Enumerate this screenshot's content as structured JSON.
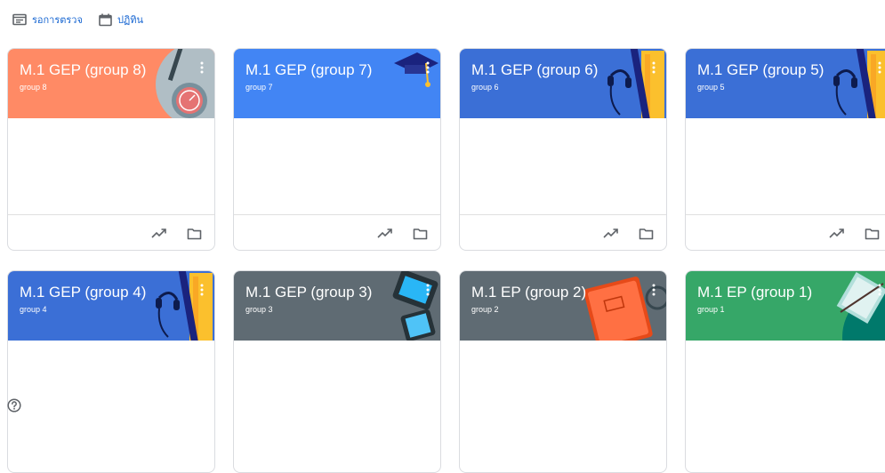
{
  "toolbar": {
    "to_review_label": "รอการตรวจ",
    "calendar_label": "ปฏิทิน"
  },
  "colors": {
    "orange": "#ff8a65",
    "blue": "#4285f4",
    "royal": "#3b6fd6",
    "slate": "#5f6b73",
    "green": "#36a768",
    "link": "#1967d2"
  },
  "classes": [
    {
      "title": "M.1 GEP (group 8)",
      "section": "group 8",
      "theme": "orange",
      "art": "compass-art"
    },
    {
      "title": "M.1 GEP (group 7)",
      "section": "group 7",
      "theme": "blue",
      "art": "graduation-cap-art"
    },
    {
      "title": "M.1 GEP (group 6)",
      "section": "group 6",
      "theme": "royal",
      "art": "books-headphones-art"
    },
    {
      "title": "M.1 GEP (group 5)",
      "section": "group 5",
      "theme": "royal",
      "art": "books-headphones-art"
    },
    {
      "title": "M.1 GEP (group 4)",
      "section": "group 4",
      "theme": "royal",
      "art": "books-headphones-art"
    },
    {
      "title": "M.1 GEP (group 3)",
      "section": "group 3",
      "theme": "slate",
      "art": "tablets-art"
    },
    {
      "title": "M.1 EP (group 2)",
      "section": "group 2",
      "theme": "slate",
      "art": "notebook-art"
    },
    {
      "title": "M.1 EP (group 1)",
      "section": "group 1",
      "theme": "green",
      "art": "book-leaf-art"
    }
  ],
  "icons": {
    "menu": "more-vert-icon",
    "progress": "trending-up-icon",
    "folder": "folder-icon",
    "help": "help-icon"
  }
}
